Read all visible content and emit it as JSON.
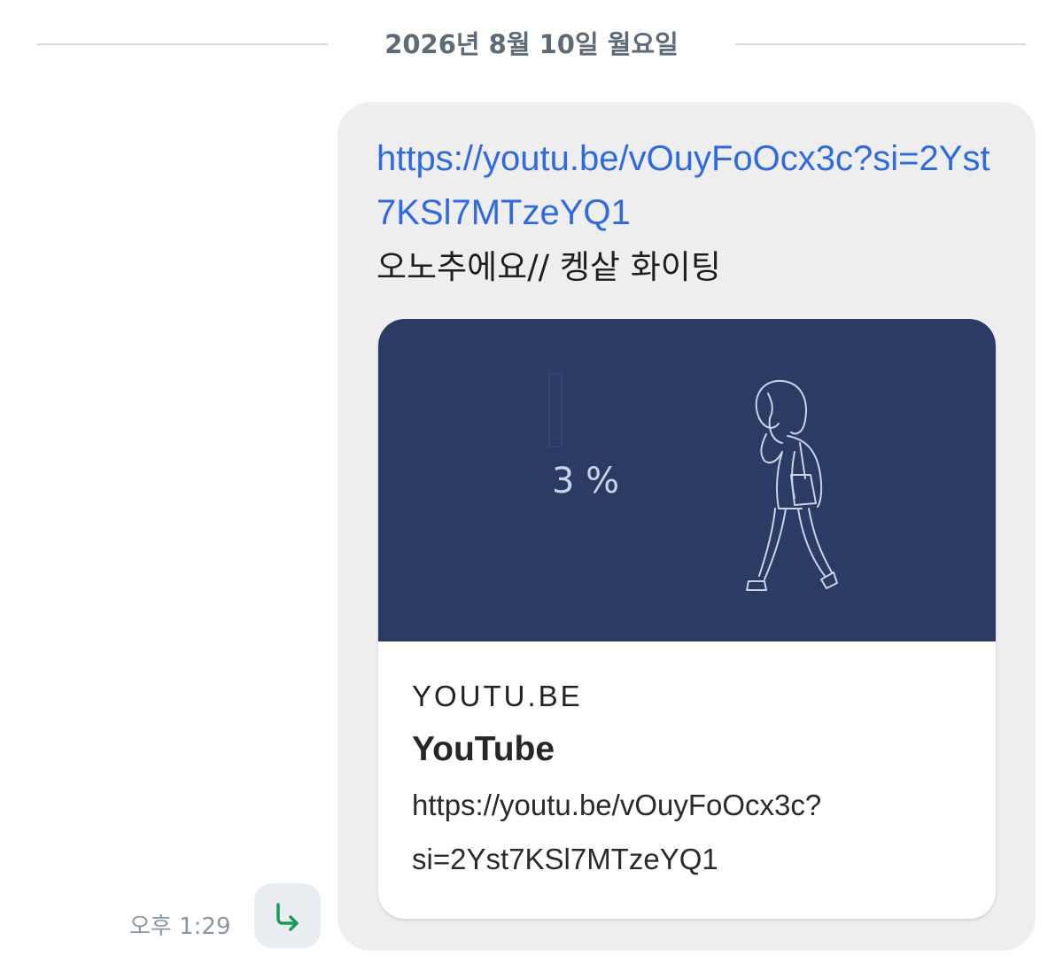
{
  "date_divider": {
    "label": "2026년 8월 10일 월요일"
  },
  "message": {
    "link_text": "https://youtu.be/vOuyFoOcx3c?si=2Yst7KSl7MTzeYQ1",
    "body_text": "오노추에요// 켕샅 화이팅",
    "time": "오후 1:29"
  },
  "link_preview": {
    "thumbnail_text": "3 %",
    "domain": "YOUTU.BE",
    "title": "YouTube",
    "url_line1": "https://youtu.be/vOuyFoOcx3c?",
    "url_line2": "si=2Yst7KSl7MTzeYQ1"
  },
  "share": {
    "icon": "forward-arrow-icon"
  },
  "colors": {
    "link": "#2f6be0",
    "bubble_bg": "#eeeeee",
    "thumbnail_bg": "#2b3b63",
    "share_arrow": "#1a9a5a",
    "divider_text": "#5d6a78"
  }
}
